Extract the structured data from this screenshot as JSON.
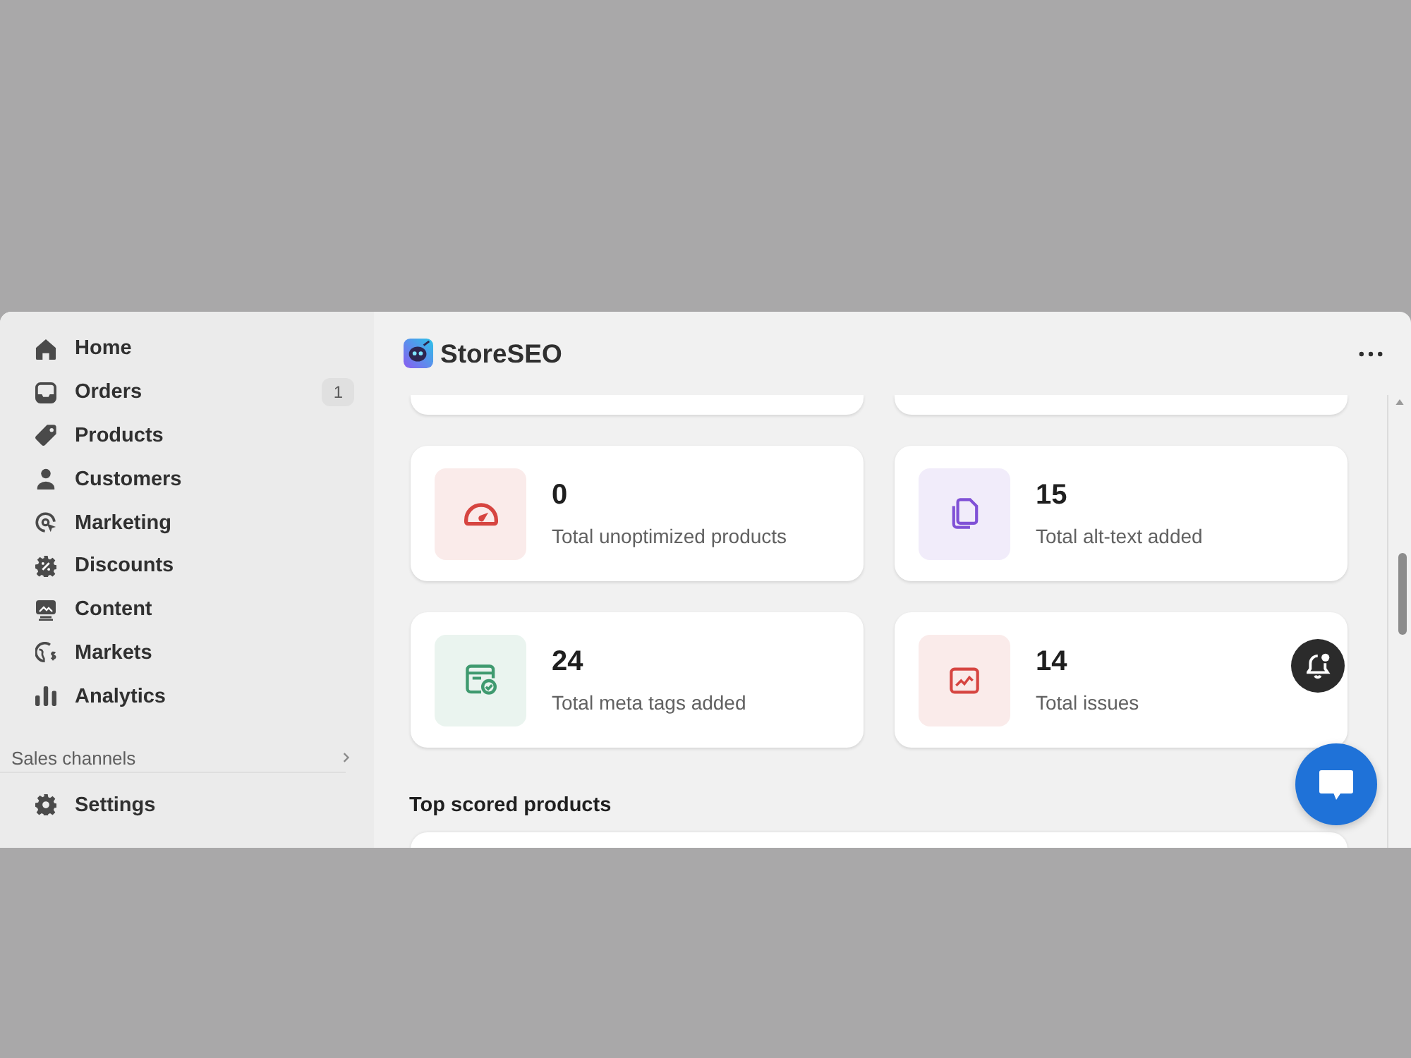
{
  "app": {
    "name": "StoreSEO"
  },
  "sidebar": {
    "items": [
      {
        "label": "Home",
        "selected": false
      },
      {
        "label": "Orders",
        "badge": "1",
        "selected": false
      },
      {
        "label": "Products",
        "selected": false
      },
      {
        "label": "Customers",
        "selected": false
      },
      {
        "label": "Marketing",
        "selected": false
      },
      {
        "label": "Discounts",
        "selected": false
      },
      {
        "label": "Content",
        "selected": false
      },
      {
        "label": "Markets",
        "selected": false
      },
      {
        "label": "Analytics",
        "selected": false
      }
    ],
    "sections": [
      {
        "title": "Sales channels",
        "expanded": false
      }
    ],
    "bottom_items": [
      {
        "label": "Settings",
        "selected": false
      }
    ]
  },
  "stats": [
    {
      "value": "0",
      "label": "Total unoptimized products",
      "color": "#d64541"
    },
    {
      "value": "15",
      "label": "Total alt-text added",
      "color": "#8051d6"
    },
    {
      "value": "24",
      "label": "Total meta tags added",
      "color": "#3f9a6f"
    },
    {
      "value": "14",
      "label": "Total issues",
      "color": "#d64541"
    }
  ],
  "top_scored": {
    "title": "Top scored products"
  }
}
